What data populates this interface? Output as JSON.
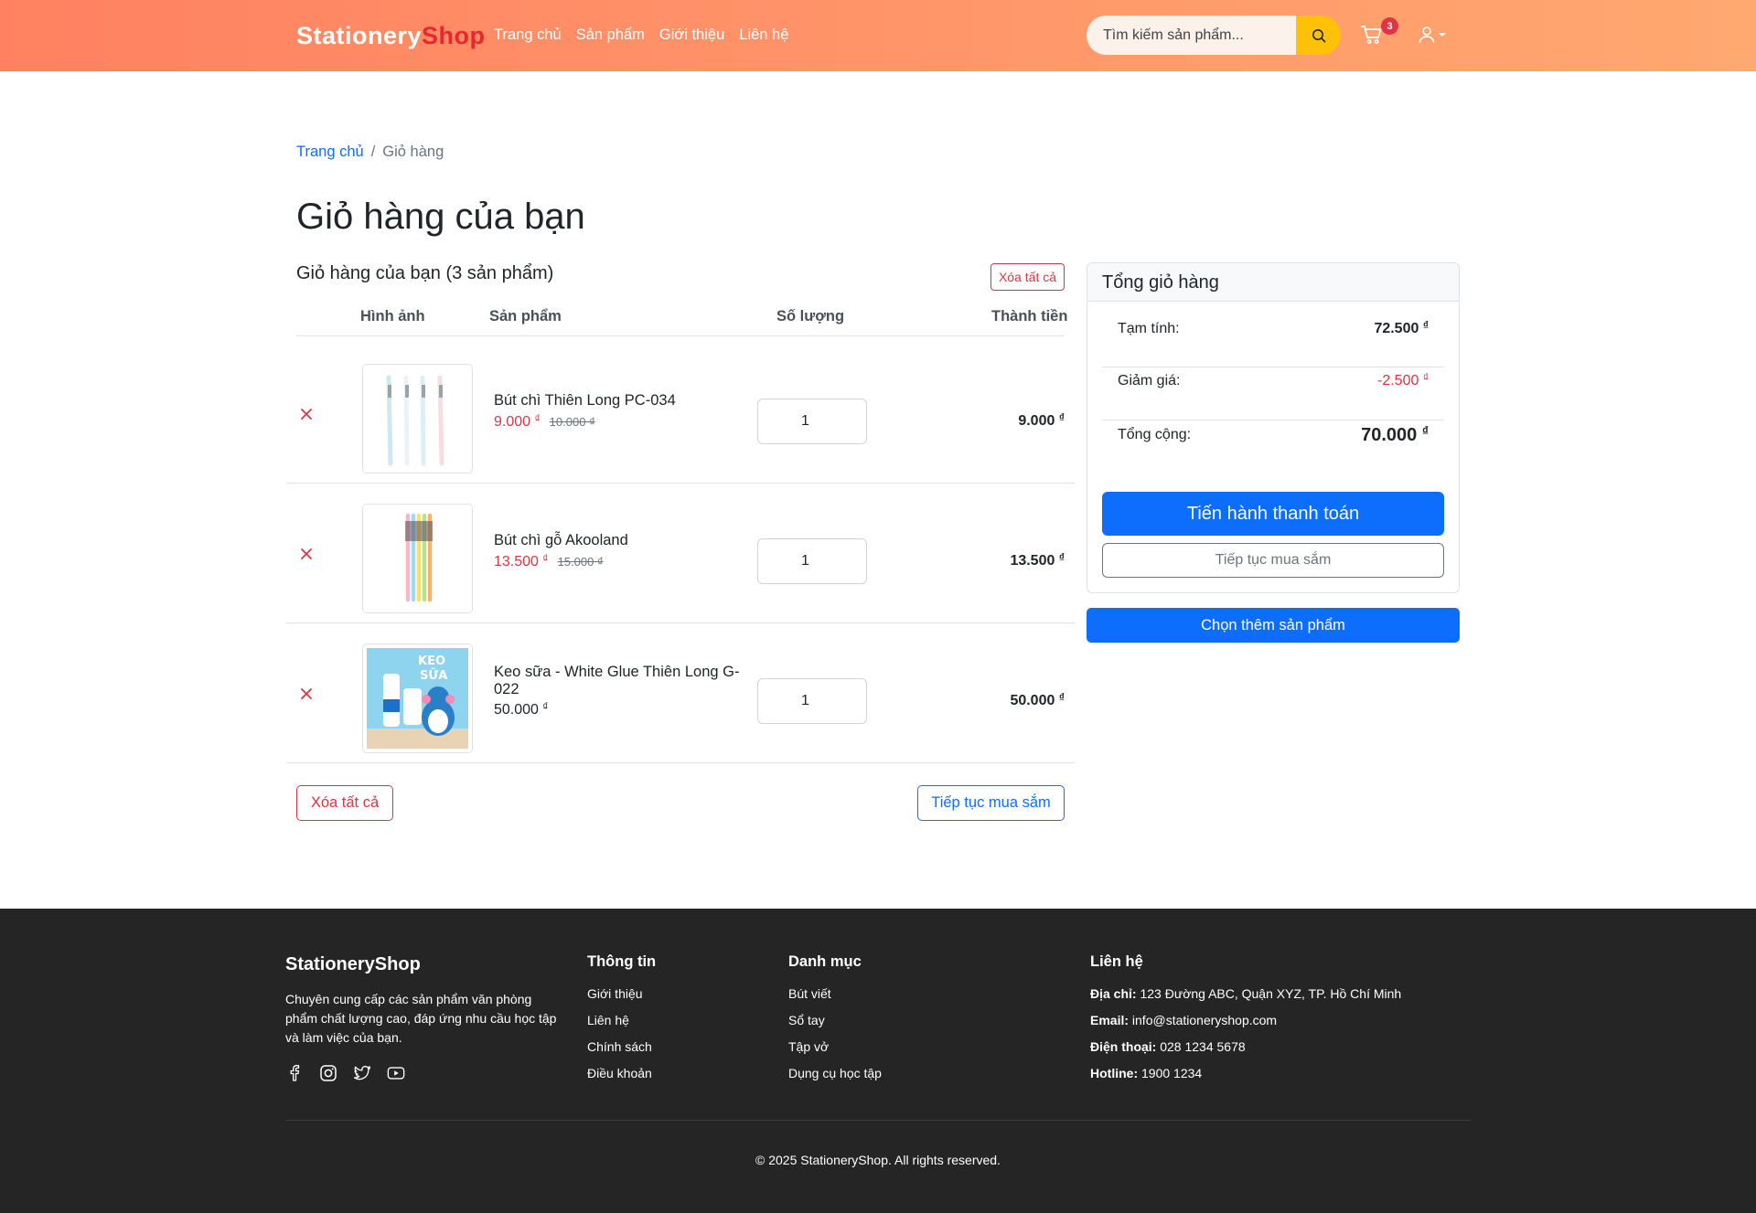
{
  "header": {
    "brand_main": "Stationery",
    "brand_accent": "Shop",
    "nav": [
      "Trang chủ",
      "Sản phẩm",
      "Giới thiệu",
      "Liên hệ"
    ],
    "search_placeholder": "Tìm kiếm sản phẩm...",
    "cart_badge": "3"
  },
  "breadcrumb": {
    "home": "Trang chủ",
    "sep": "/",
    "current": "Giỏ hàng"
  },
  "page_title": "Giỏ hàng của bạn",
  "cart": {
    "count_label": "Giỏ hàng của bạn (3 sản phẩm)",
    "clear_all": "Xóa tất cả",
    "columns": {
      "image": "Hình ảnh",
      "product": "Sản phẩm",
      "quantity": "Số lượng",
      "total": "Thành tiền"
    },
    "items": [
      {
        "name": "Bút chì Thiên Long PC-034",
        "price": "9.000",
        "original_price": "10.000",
        "qty": "1",
        "total": "9.000"
      },
      {
        "name": "Bút chì gỗ Akooland",
        "price": "13.500",
        "original_price": "15.000",
        "qty": "1",
        "total": "13.500"
      },
      {
        "name": "Keo sữa - White Glue Thiên Long G-022",
        "price": "50.000",
        "original_price": "",
        "qty": "1",
        "total": "50.000"
      }
    ],
    "clear_all_bottom": "Xóa tất cả",
    "continue_shopping": "Tiếp tục mua sắm",
    "currency": "₫"
  },
  "summary": {
    "title": "Tổng giỏ hàng",
    "subtotal_label": "Tạm tính:",
    "subtotal": "72.500",
    "discount_label": "Giảm giá:",
    "discount": "-2.500",
    "total_label": "Tổng cộng:",
    "total": "70.000",
    "checkout": "Tiến hành thanh toán",
    "continue": "Tiếp tục mua sắm",
    "more_products": "Chọn thêm sản phẩm"
  },
  "footer": {
    "brand": "StationeryShop",
    "description": "Chuyên cung cấp các sản phẩm văn phòng phẩm chất lượng cao, đáp ứng nhu cầu học tập và làm việc của bạn.",
    "info_title": "Thông tin",
    "info_links": [
      "Giới thiệu",
      "Liên hệ",
      "Chính sách",
      "Điều khoản"
    ],
    "category_title": "Danh mục",
    "category_links": [
      "Bút viết",
      "Sổ tay",
      "Tập vở",
      "Dụng cụ học tập"
    ],
    "contact_title": "Liên hệ",
    "contact": [
      {
        "label": "Địa chỉ:",
        "value": "123 Đường ABC, Quận XYZ, TP. Hồ Chí Minh"
      },
      {
        "label": "Email:",
        "value": "info@stationeryshop.com"
      },
      {
        "label": "Điện thoại:",
        "value": "028 1234 5678"
      },
      {
        "label": "Hotline:",
        "value": "1900 1234"
      }
    ],
    "copyright": "© 2025 StationeryShop. All rights reserved."
  }
}
